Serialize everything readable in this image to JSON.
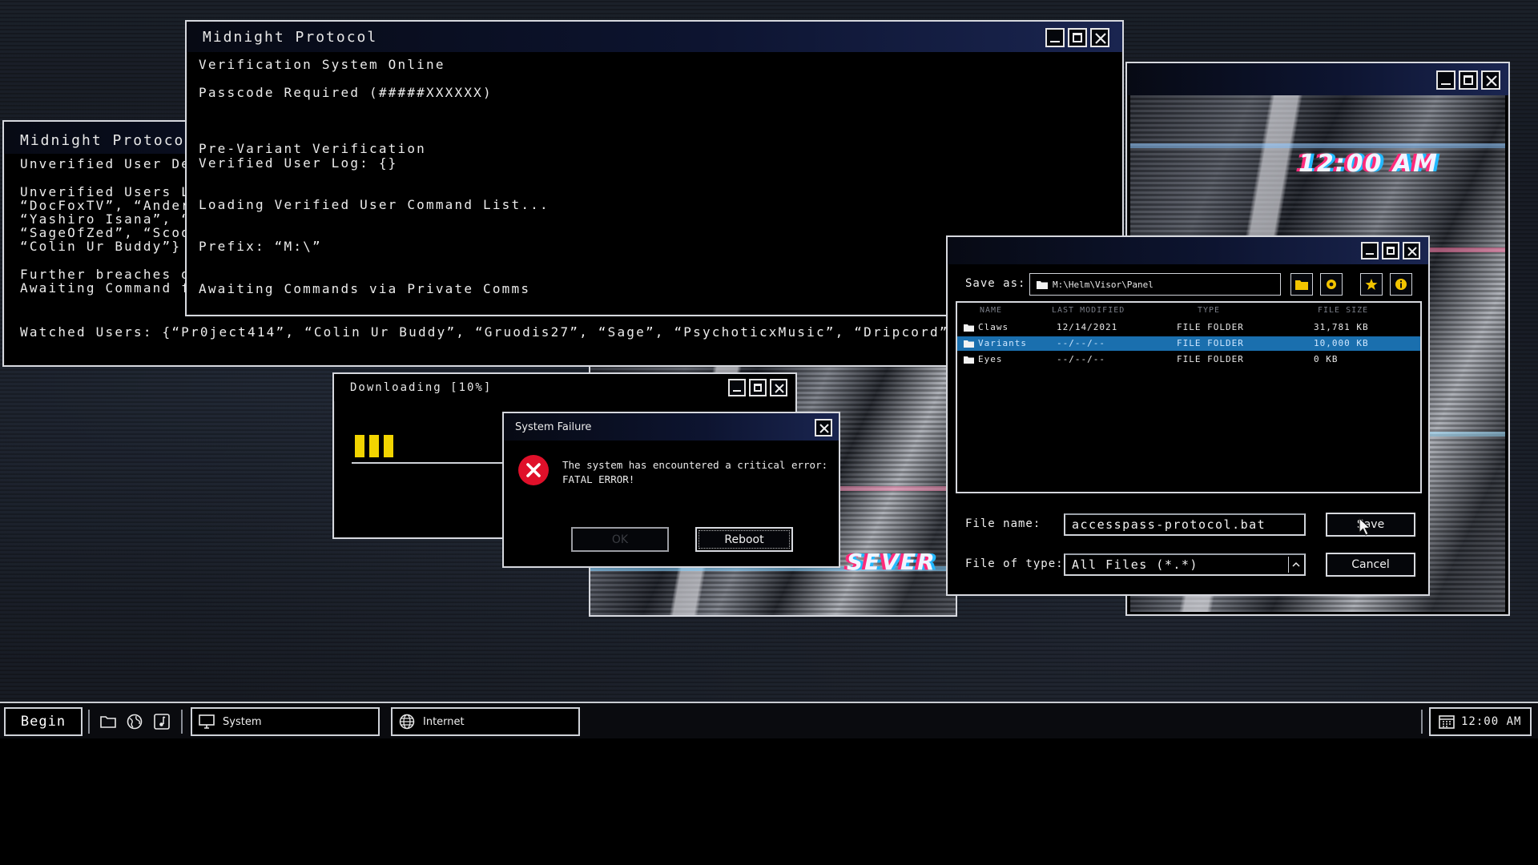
{
  "terminal_main": {
    "title": "Midnight Protocol",
    "lines": [
      "Verification System Online",
      "Passcode Required (#####XXXXXX)",
      "Pre-Variant Verification",
      "Verified User Log: {}",
      "Loading Verified User Command List...",
      "Prefix: “M:\\”",
      "Awaiting Commands via Private Comms"
    ]
  },
  "terminal_back": {
    "title": "Midnight Protocol",
    "lines": [
      "Unverified User Detec",
      "Unverified Users Log:",
      "“DocFoxTV”, “Andercla",
      "“Yashiro Isana”, “ArKa",
      "“SageOfZed”, “Scootie",
      "“Colin Ur Buddy”}",
      "Further breaches dete",
      "Awaiting Command fro"
    ],
    "watched": "Watched Users: {“Pr0ject414”, “Colin Ur Buddy”, “Gruodis27”, “Sage”, “PsychoticxMusic”, “Dripcord”}"
  },
  "glitch_window": {
    "overlay_text": "12:00 AM",
    "strip_text": "SEVER"
  },
  "download": {
    "title": "Downloading  [10%]",
    "progress": 0.1
  },
  "error_dialog": {
    "title": "System Failure",
    "message_line1": "The system has encountered a critical error:",
    "message_line2": "FATAL ERROR!",
    "ok_label": "OK",
    "reboot_label": "Reboot"
  },
  "save_dialog": {
    "save_as_label": "Save as:",
    "path": "M:\\Helm\\Visor\\Panel",
    "columns": [
      "NAME",
      "LAST MODIFIED",
      "TYPE",
      "FILE SIZE"
    ],
    "rows": [
      {
        "name": "Claws",
        "modified": "12/14/2021",
        "type": "FILE FOLDER",
        "size": "31,781 KB"
      },
      {
        "name": "Variants",
        "modified": "--/--/--",
        "type": "FILE FOLDER",
        "size": "10,000 KB"
      },
      {
        "name": "Eyes",
        "modified": "--/--/--",
        "type": "FILE FOLDER",
        "size": "0 KB"
      }
    ],
    "selected_row": 1,
    "file_name_label": "File name:",
    "file_name_value": "accesspass-protocol.bat",
    "file_type_label": "File of type:",
    "file_type_value": "All Files (*.*)",
    "save_label": "Save",
    "cancel_label": "Cancel"
  },
  "taskbar": {
    "start_label": "Begin",
    "tasks": [
      "System",
      "Internet"
    ],
    "clock": "12:00 AM"
  },
  "colors": {
    "accent": "#1a6fae",
    "progress": "#f2d400",
    "error": "#e0102a"
  }
}
